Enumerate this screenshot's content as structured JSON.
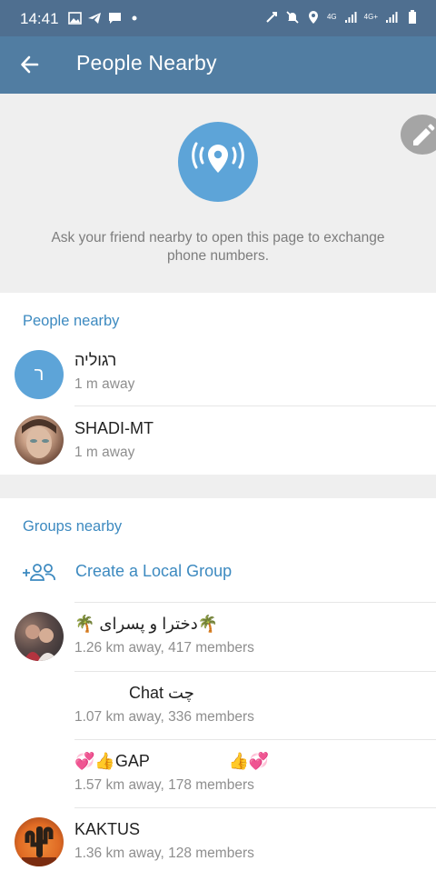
{
  "status": {
    "time": "14:41",
    "net_a": "4G",
    "net_b": "4G+"
  },
  "appbar": {
    "title": "People Nearby"
  },
  "hero": {
    "hint": "Ask your friend nearby to open this page to exchange phone numbers."
  },
  "people": {
    "title": "People nearby",
    "items": [
      {
        "name": "רגוליה",
        "distance": "1 m away",
        "initial": "ר"
      },
      {
        "name": "SHADI-MT",
        "distance": "1 m away"
      }
    ]
  },
  "groups": {
    "title": "Groups nearby",
    "create_label": "Create a Local Group",
    "items": [
      {
        "name": "🌴دخترا و پسرای 🌴",
        "info": "1.26 km away, 417 members"
      },
      {
        "name": "Chat چت",
        "info": "1.07 km away, 336 members"
      },
      {
        "name": "💞👍GAP 👍💞",
        "info": "1.57 km away, 178 members"
      },
      {
        "name": "KAKTUS",
        "info": "1.36 km away, 128 members"
      }
    ]
  },
  "colors": {
    "appbar": "#517da2",
    "accent": "#3d8ac0",
    "avatar_blue": "#5da4d8"
  },
  "icons": {
    "back": "arrow-left-icon",
    "location": "location-broadcast-icon",
    "edit": "pencil-icon",
    "create_group": "add-group-icon"
  }
}
